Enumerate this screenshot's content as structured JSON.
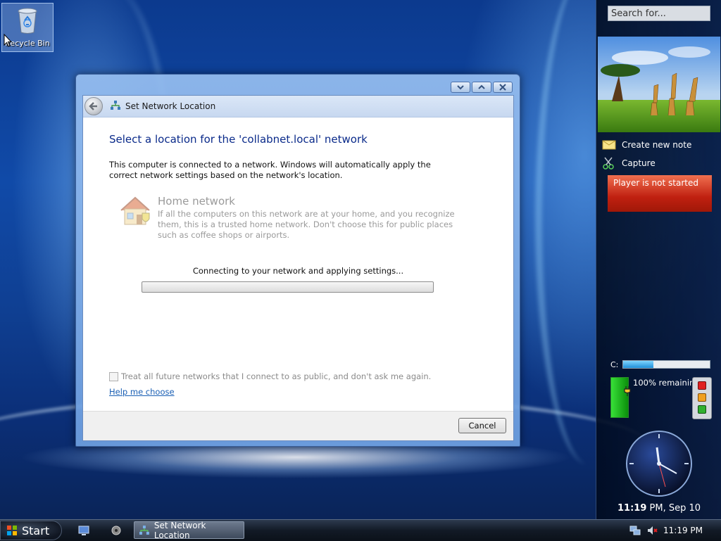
{
  "desktop": {
    "recycle_bin_label": "Recycle Bin"
  },
  "dialog": {
    "nav_title": "Set Network Location",
    "heading": "Select a location for the 'collabnet.local' network",
    "description": "This computer is connected to a network. Windows will automatically apply the correct network settings based on the network's location.",
    "option_title": "Home network",
    "option_description": "If all the computers on this network are at your home, and you recognize them, this is a trusted home network.  Don't choose this for public places such as coffee shops or airports.",
    "status_text": "Connecting to your network and applying settings...",
    "progress": 0,
    "checkbox_label": "Treat all future networks that I connect to as public, and don't ask me again.",
    "checkbox_checked": false,
    "help_link": "Help me choose",
    "cancel_label": "Cancel"
  },
  "sidebar": {
    "search_placeholder": "Search for...",
    "notes_label": "Create new note",
    "capture_label": "Capture",
    "player_status": "Player is not started",
    "drive_label": "C:",
    "drive_used_fraction": 0.35,
    "battery_text": "100% remaining",
    "battery_level": 1.0,
    "clock_time": "11:19",
    "clock_suffix": " PM, Sep 10"
  },
  "taskbar": {
    "start_label": "Start",
    "active_window": "Set Network Location",
    "tray_time": "11:19 PM"
  },
  "colors": {
    "accent": "#0a2a8a",
    "link": "#1a5fb4",
    "player_red": "#c02010",
    "battery_green": "#38e038"
  }
}
